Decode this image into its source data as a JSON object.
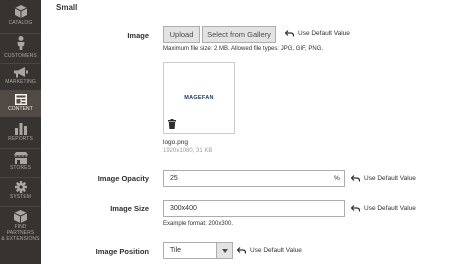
{
  "sidebar": {
    "items": [
      {
        "label": "CATALOG",
        "icon": "cube-icon"
      },
      {
        "label": "CUSTOMERS",
        "icon": "person-icon"
      },
      {
        "label": "MARKETING",
        "icon": "megaphone-icon"
      },
      {
        "label": "CONTENT",
        "icon": "layout-icon",
        "active": true
      },
      {
        "label": "REPORTS",
        "icon": "bar-chart-icon"
      },
      {
        "label": "STORES",
        "icon": "storefront-icon"
      },
      {
        "label": "SYSTEM",
        "icon": "gear-icon"
      },
      {
        "label": "FIND PARTNERS",
        "label2": "& EXTENSIONS",
        "icon": "puzzle-cube-icon"
      }
    ]
  },
  "section": {
    "title": "Small"
  },
  "image": {
    "label": "Image",
    "upload_label": "Upload",
    "gallery_label": "Select from Gallery",
    "use_default": "Use Default Value",
    "note": "Maximum file size: 2 MB. Allowed file types: JPG, GIF, PNG.",
    "preview_text": "MAGEFAN",
    "file_name": "logo.png",
    "file_meta": "1920x1080, 31 KB"
  },
  "opacity": {
    "label": "Image Opacity",
    "value": "25",
    "suffix": "%",
    "use_default": "Use Default Value"
  },
  "size": {
    "label": "Image Size",
    "value": "300x400",
    "use_default": "Use Default Value",
    "note": "Example format: 200x300."
  },
  "position": {
    "label": "Image Position",
    "value": "Tile",
    "use_default": "Use Default Value"
  },
  "colors": {
    "sidebar_bg": "#373330",
    "sidebar_active": "#514943",
    "sidebar_text": "#aaa6a0"
  }
}
